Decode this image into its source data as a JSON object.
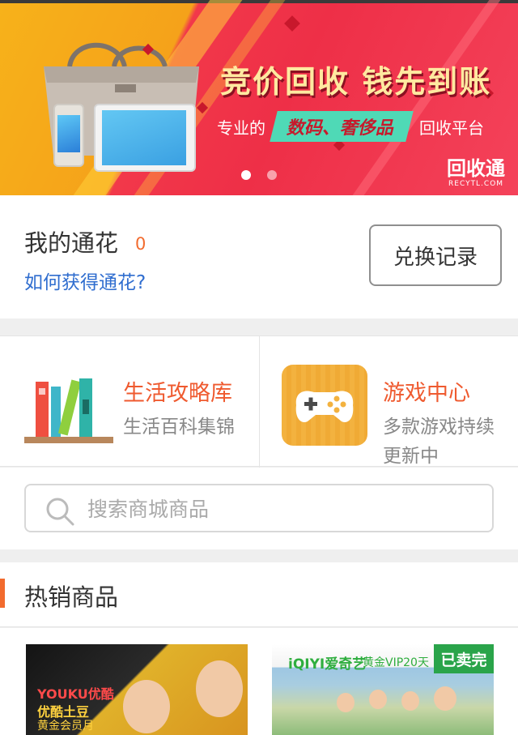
{
  "banner": {
    "slogan": "竞价回收  钱先到账",
    "sub_prefix": "专业的",
    "sub_highlight": "数码、奢侈品",
    "sub_suffix": "回收平台",
    "logo_text": "回收通",
    "logo_sub": "RECYTL.COM",
    "slide_count": 2,
    "active_slide": 1
  },
  "points": {
    "title": "我的通花",
    "count": "0",
    "how_link": "如何获得通花?",
    "exchange_button": "兑换记录"
  },
  "categories": [
    {
      "title": "生活攻略库",
      "subtitle": "生活百科集锦",
      "icon": "books-icon"
    },
    {
      "title": "游戏中心",
      "subtitle": "多款游戏持续更新中",
      "icon": "gamepad-icon"
    }
  ],
  "search": {
    "placeholder": "搜索商城商品",
    "value": ""
  },
  "hot": {
    "title": "热销商品",
    "products": [
      {
        "brand": "YOUKU优酷",
        "name": "优酷土豆",
        "tag": "黄金会员月",
        "sold_out": false
      },
      {
        "brand": "iQIYI爱奇艺",
        "tag": "黄金VIP20天",
        "sold_out": true,
        "sold_label": "已卖完"
      }
    ]
  },
  "colors": {
    "accent": "#f26b2e",
    "link": "#2f6dcf",
    "sold": "#2aa44a"
  }
}
